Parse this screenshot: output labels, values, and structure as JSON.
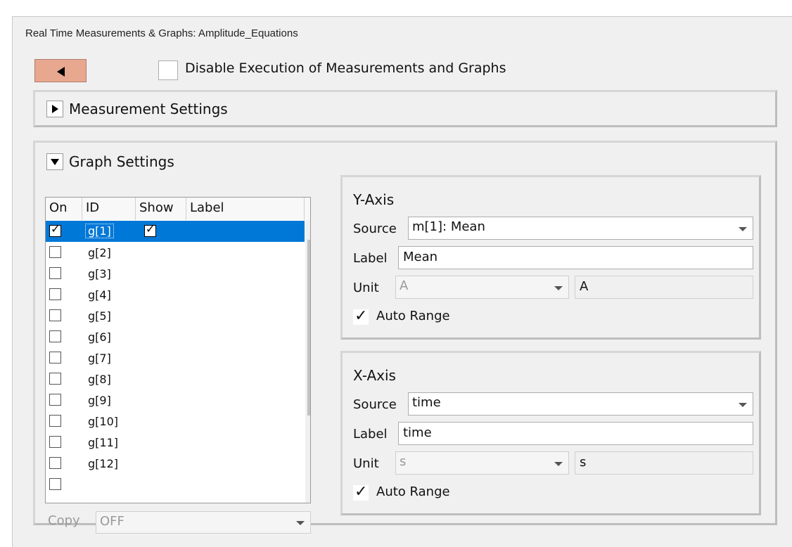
{
  "window": {
    "title": "Real Time Measurements & Graphs: Amplitude_Equations"
  },
  "toolbar": {
    "back_icon": "triangle-left-icon",
    "disable_label": "Disable Execution of Measurements and Graphs",
    "disable_checked": false
  },
  "measurement_settings": {
    "label": "Measurement Settings",
    "expanded": false
  },
  "graph_settings": {
    "label": "Graph Settings",
    "expanded": true,
    "columns": [
      "On",
      "ID",
      "Show",
      "Label"
    ],
    "rows": [
      {
        "id": "g[1]",
        "on": true,
        "show": true,
        "selected": true
      },
      {
        "id": "g[2]",
        "on": false
      },
      {
        "id": "g[3]",
        "on": false
      },
      {
        "id": "g[4]",
        "on": false
      },
      {
        "id": "g[5]",
        "on": false
      },
      {
        "id": "g[6]",
        "on": false
      },
      {
        "id": "g[7]",
        "on": false
      },
      {
        "id": "g[8]",
        "on": false
      },
      {
        "id": "g[9]",
        "on": false
      },
      {
        "id": "g[10]",
        "on": false
      },
      {
        "id": "g[11]",
        "on": false
      },
      {
        "id": "g[12]",
        "on": false
      }
    ],
    "copy_label": "Copy",
    "copy_value": "OFF"
  },
  "y_axis": {
    "title": "Y-Axis",
    "source_label": "Source",
    "source_value": "m[1]: Mean",
    "label_label": "Label",
    "label_value": "Mean",
    "unit_label": "Unit",
    "unit_value": "A",
    "unit_display": "A",
    "auto_range_label": "Auto Range",
    "auto_range": true
  },
  "x_axis": {
    "title": "X-Axis",
    "source_label": "Source",
    "source_value": "time",
    "label_label": "Label",
    "label_value": "time",
    "unit_label": "Unit",
    "unit_value": "s",
    "unit_display": "s",
    "auto_range_label": "Auto Range",
    "auto_range": true
  },
  "colors": {
    "back_button": "#e8a890",
    "selection": "#0078d7"
  }
}
